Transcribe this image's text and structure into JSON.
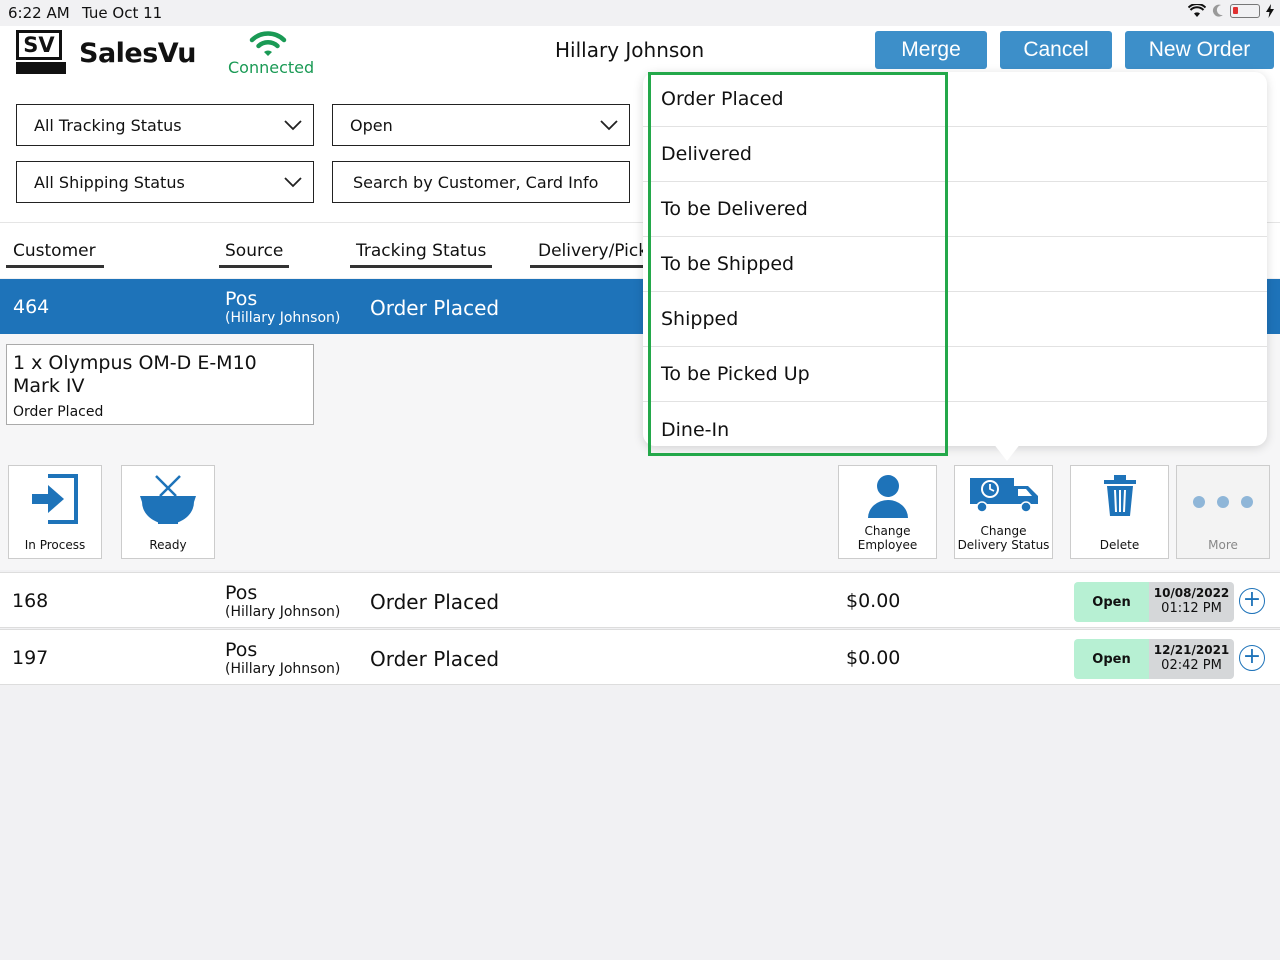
{
  "status_bar": {
    "time": "6:22 AM",
    "date": "Tue Oct 11"
  },
  "header": {
    "logo_text": "SV",
    "brand": "SalesVu",
    "connection": "Connected",
    "user": "Hillary  Johnson",
    "buttons": {
      "merge": "Merge",
      "cancel": "Cancel",
      "new_order": "New Order"
    }
  },
  "filters": {
    "tracking": "All Tracking Status",
    "open": "Open",
    "shipping": "All Shipping Status",
    "search_placeholder": "Search by Customer, Card Info"
  },
  "columns": [
    "Customer",
    "Source",
    "Tracking Status",
    "Delivery/Pick"
  ],
  "selected_order": {
    "id": "464",
    "source": "Pos",
    "source_user": "(Hillary  Johnson)",
    "tracking": "Order Placed",
    "item": {
      "title": "1 x Olympus OM-D E-M10 Mark IV",
      "status": "Order Placed"
    }
  },
  "actions": {
    "in_process": "In Process",
    "ready": "Ready",
    "change_employee": [
      "Change",
      "Employee"
    ],
    "change_delivery": [
      "Change",
      "Delivery Status"
    ],
    "delete": "Delete",
    "more": "More"
  },
  "orders": [
    {
      "id": "168",
      "source": "Pos",
      "source_user": "(Hillary  Johnson)",
      "tracking": "Order Placed",
      "amount": "$0.00",
      "status": "Open",
      "date": "10/08/2022",
      "time": "01:12 PM"
    },
    {
      "id": "197",
      "source": "Pos",
      "source_user": "(Hillary  Johnson)",
      "tracking": "Order Placed",
      "amount": "$0.00",
      "status": "Open",
      "date": "12/21/2021",
      "time": "02:42 PM"
    }
  ],
  "delivery_options": [
    "Order Placed",
    "Delivered",
    "To be Delivered",
    "To be Shipped",
    "Shipped",
    "To be Picked Up",
    "Dine-In"
  ],
  "colors": {
    "accent": "#3d8fc9",
    "selected_row": "#1e73b9",
    "connected": "#1a9a55",
    "open_badge": "#b7f0d3",
    "highlight": "#23a84a"
  }
}
